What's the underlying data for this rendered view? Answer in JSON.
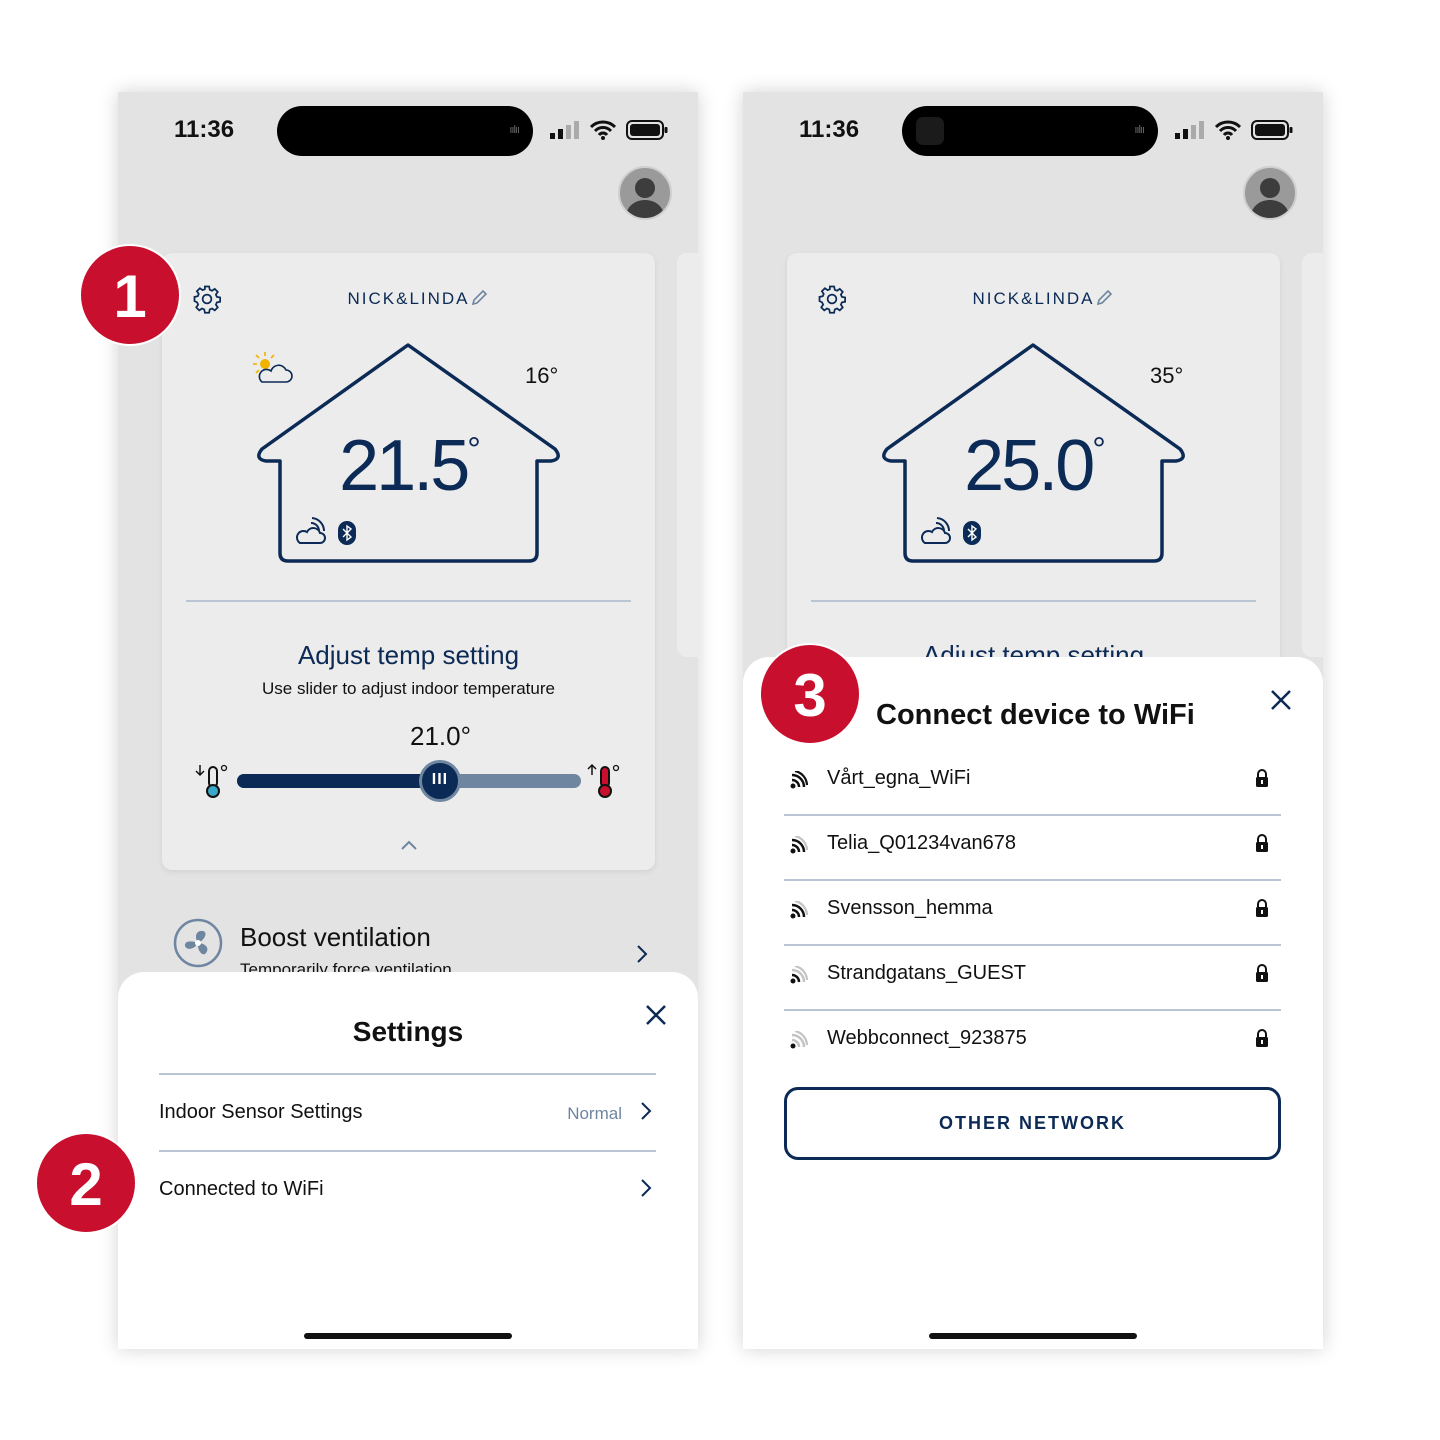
{
  "accent_color": "#0b2a55",
  "badge_color": "#c8102e",
  "phones": [
    {
      "status": {
        "time": "11:36"
      },
      "device_name": "NICK&LINDA",
      "outdoor_temp": "16°",
      "indoor_temp": "21.5",
      "weather_icon": "partly-sunny-icon"
    },
    {
      "status": {
        "time": "11:36"
      },
      "device_name": "NICK&LINDA",
      "outdoor_temp": "35°",
      "indoor_temp": "25.0"
    }
  ],
  "adjust": {
    "title": "Adjust temp setting",
    "subtitle": "Use slider to adjust indoor temperature",
    "setpoint": "21.0°",
    "slider_position_pct": 59,
    "thumb_glyph": "III"
  },
  "boost": {
    "title": "Boost ventilation",
    "subtitle": "Temporarily force ventilation"
  },
  "settings_sheet": {
    "title": "Settings",
    "rows": [
      {
        "label": "Indoor Sensor Settings",
        "value": "Normal"
      },
      {
        "label": "Connected to WiFi"
      }
    ]
  },
  "wifi_sheet": {
    "title": "Connect device to WiFi",
    "networks": [
      {
        "ssid": "Vårt_egna_WiFi",
        "signal_bars": 3,
        "locked": true
      },
      {
        "ssid": "Telia_Q01234van678",
        "signal_bars": 2,
        "locked": true
      },
      {
        "ssid": "Svensson_hemma",
        "signal_bars": 2,
        "locked": true
      },
      {
        "ssid": "Strandgatans_GUEST",
        "signal_bars": 1,
        "locked": true
      },
      {
        "ssid": "Webbconnect_923875",
        "signal_bars": 0,
        "locked": true
      }
    ],
    "other_button": "OTHER NETWORK"
  },
  "badges": [
    "1",
    "2",
    "3"
  ]
}
